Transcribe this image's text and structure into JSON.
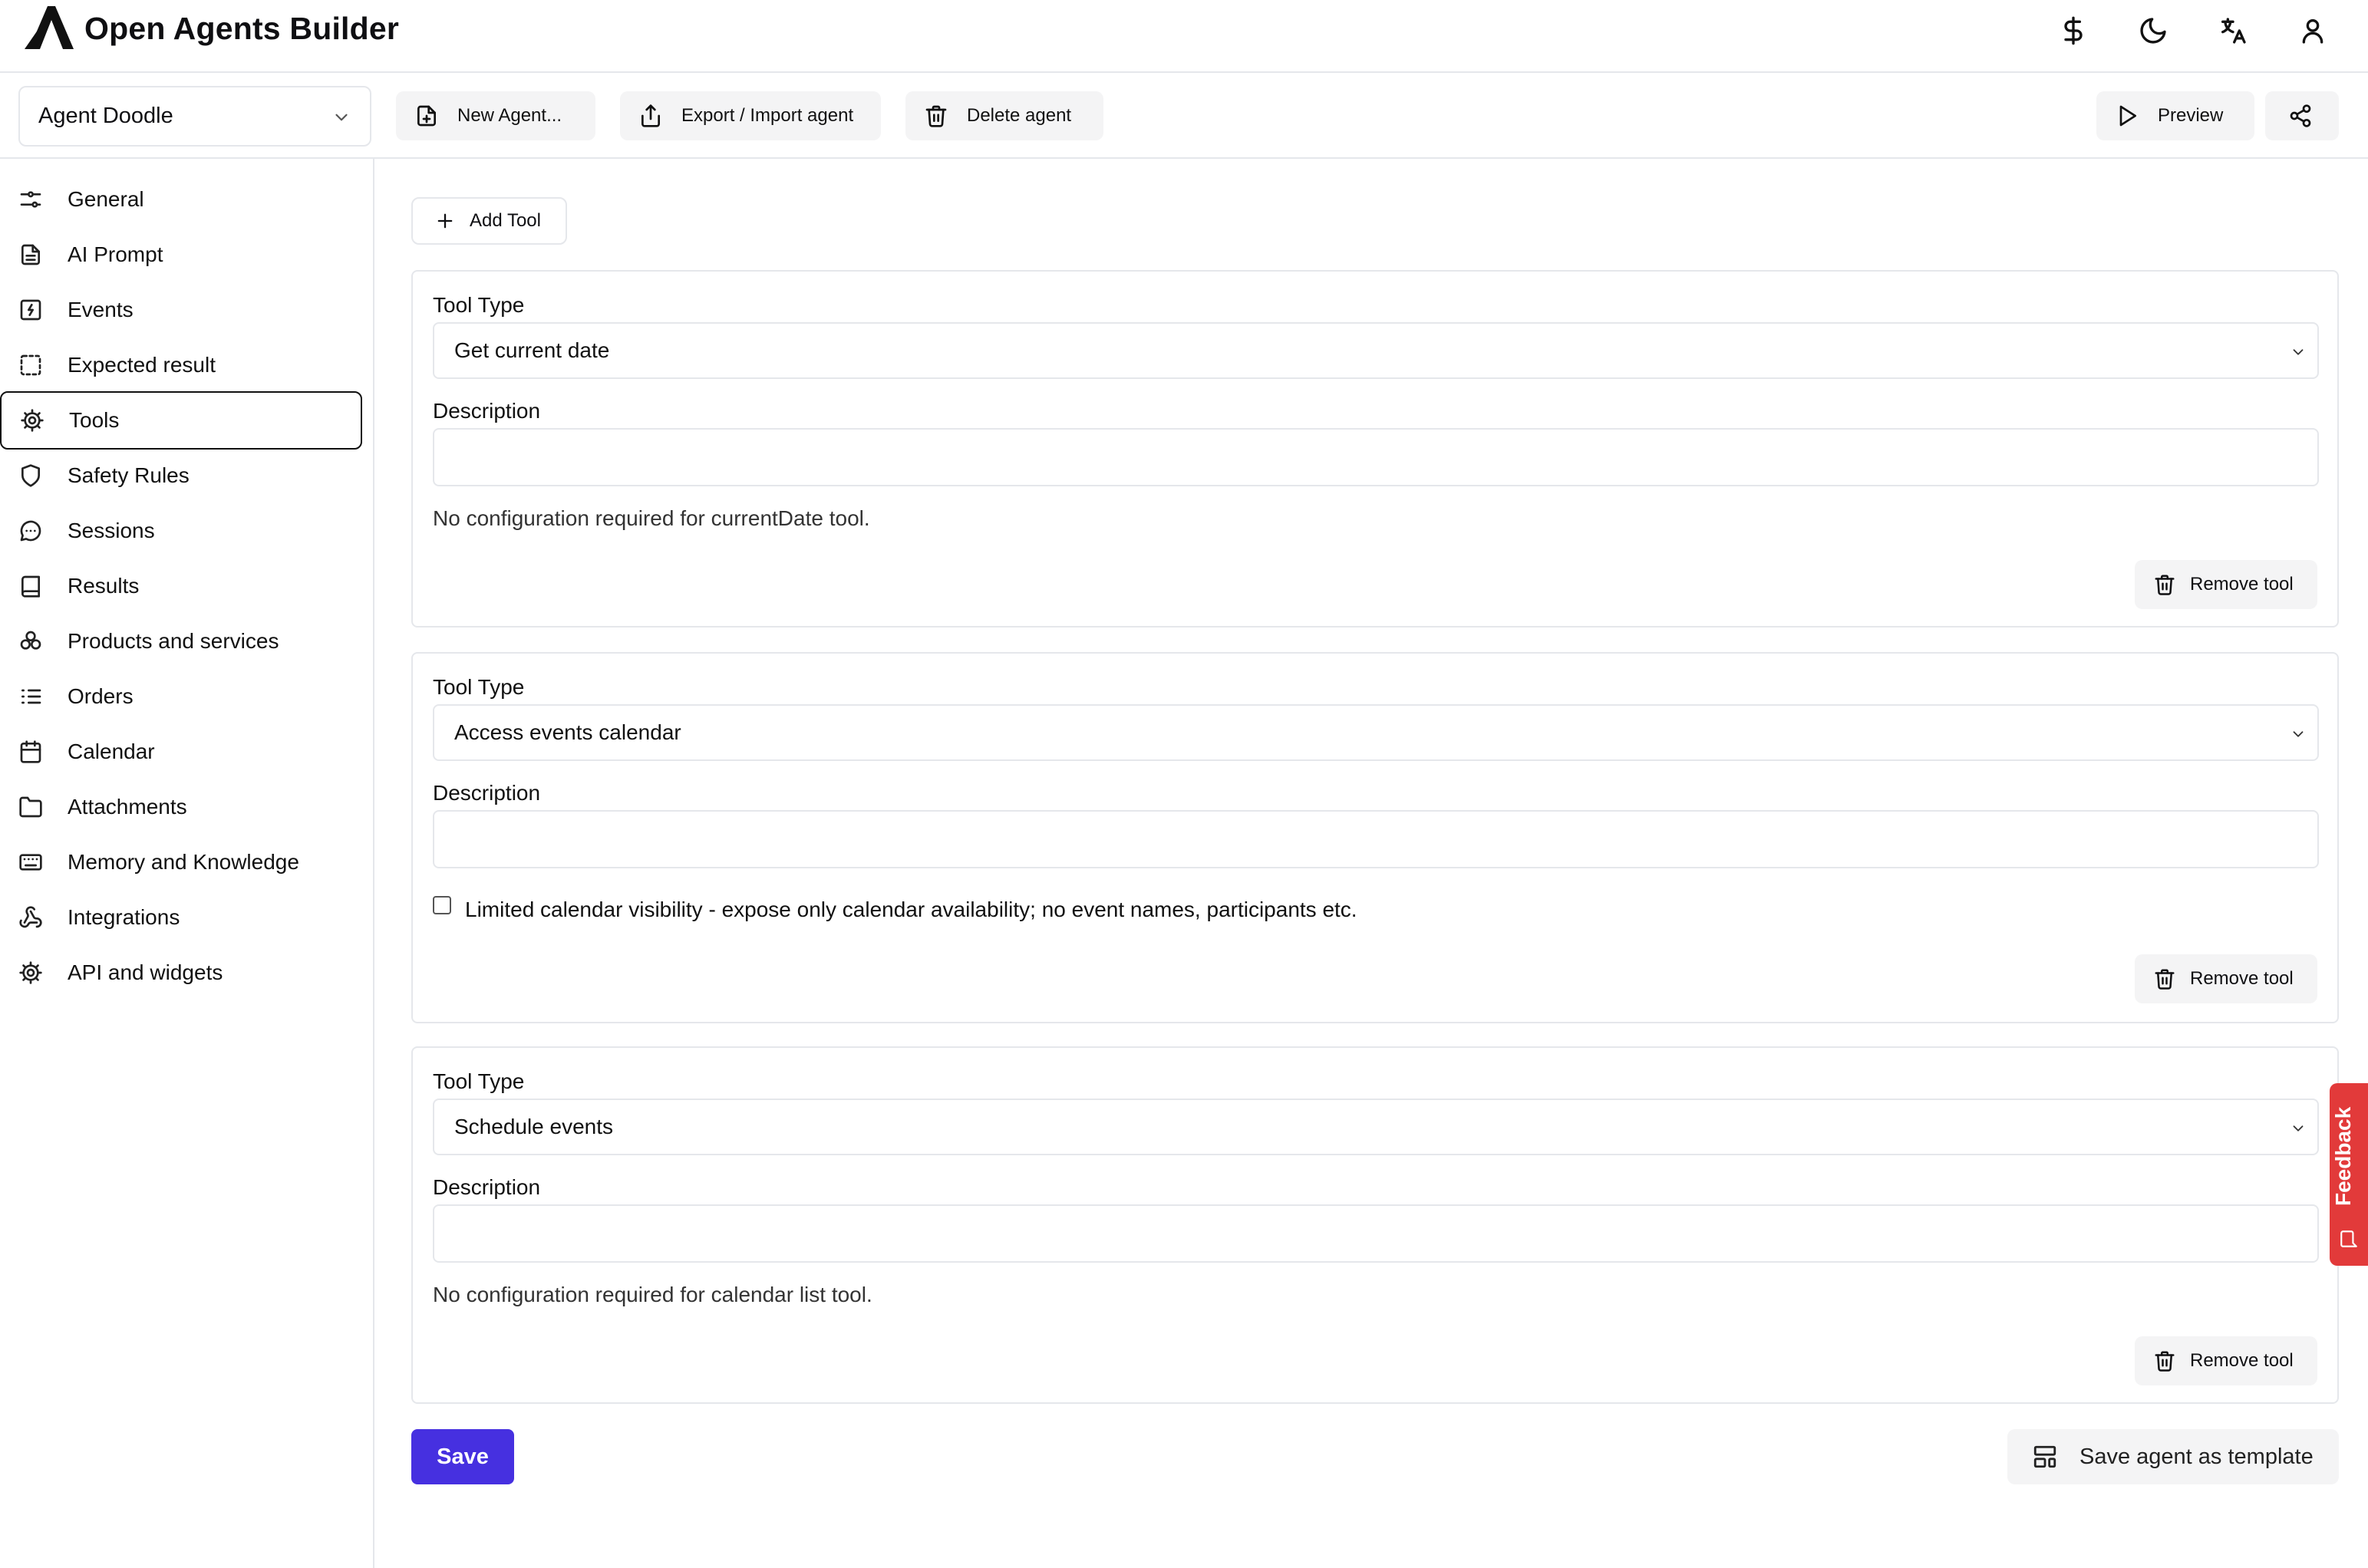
{
  "header": {
    "app_title": "Open Agents Builder",
    "icons": [
      "dollar-icon",
      "moon-icon",
      "translate-icon",
      "user-icon"
    ]
  },
  "toolbar": {
    "agent_select_value": "Agent Doodle",
    "new_agent_label": "New Agent...",
    "export_import_label": "Export / Import agent",
    "delete_agent_label": "Delete agent",
    "preview_label": "Preview"
  },
  "sidebar": {
    "items": [
      {
        "label": "General",
        "icon": "sliders-icon"
      },
      {
        "label": "AI Prompt",
        "icon": "file-text-icon"
      },
      {
        "label": "Events",
        "icon": "bolt-square-icon"
      },
      {
        "label": "Expected result",
        "icon": "dashed-square-icon"
      },
      {
        "label": "Tools",
        "icon": "gear-icon",
        "active": true
      },
      {
        "label": "Safety Rules",
        "icon": "shield-icon"
      },
      {
        "label": "Sessions",
        "icon": "message-circle-icon"
      },
      {
        "label": "Results",
        "icon": "book-icon"
      },
      {
        "label": "Products and services",
        "icon": "boxes-icon"
      },
      {
        "label": "Orders",
        "icon": "list-ordered-icon"
      },
      {
        "label": "Calendar",
        "icon": "calendar-icon"
      },
      {
        "label": "Attachments",
        "icon": "folder-icon"
      },
      {
        "label": "Memory and Knowledge",
        "icon": "keyboard-icon"
      },
      {
        "label": "Integrations",
        "icon": "webhook-icon"
      },
      {
        "label": "API and widgets",
        "icon": "gear-icon"
      }
    ]
  },
  "main": {
    "add_tool_label": "Add Tool",
    "tool_type_label": "Tool Type",
    "description_label": "Description",
    "remove_tool_label": "Remove tool",
    "tools": [
      {
        "type": "Get current date",
        "description": "",
        "note": "No configuration required for currentDate tool."
      },
      {
        "type": "Access events calendar",
        "description": "",
        "checkbox_label": "Limited calendar visibility - expose only calendar availability; no event names, participants etc.",
        "checkbox_checked": false
      },
      {
        "type": "Schedule events",
        "description": "",
        "note": "No configuration required for calendar list tool."
      }
    ],
    "save_label": "Save",
    "save_template_label": "Save agent as template"
  },
  "feedback": {
    "label": "Feedback"
  },
  "colors": {
    "accent": "#4630e0",
    "feedback": "#e23a3a",
    "border": "#e5e7eb",
    "button_bg": "#f4f4f5"
  }
}
